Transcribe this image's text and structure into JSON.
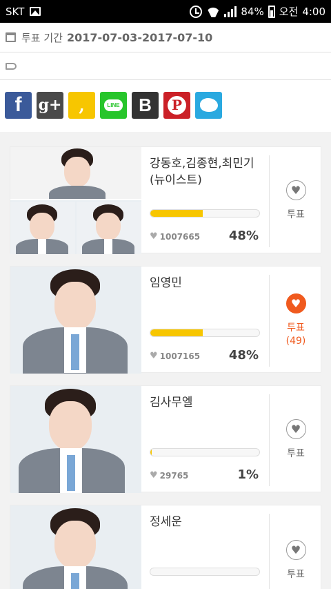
{
  "status_bar": {
    "carrier": "SKT",
    "battery": "84%",
    "ampm": "오전",
    "time": "4:00"
  },
  "period": {
    "label": "투표 기간",
    "value": "2017-07-03-2017-07-10"
  },
  "share": [
    "facebook",
    "google-plus",
    "kakaostory",
    "line",
    "band",
    "pinterest",
    "twitter"
  ],
  "share_text": {
    "line": "LINE",
    "band": "B",
    "fb": "f",
    "gp": "g+",
    "kakao": ",",
    "pin": "P"
  },
  "candidates": [
    {
      "name": "강동호,김종현,최민기(뉴이스트)",
      "votes": "1007665",
      "percent": "48%",
      "progress": 0.48,
      "vote_label": "투표",
      "vote_count": "",
      "voted": false
    },
    {
      "name": "임영민",
      "votes": "1007165",
      "percent": "48%",
      "progress": 0.48,
      "vote_label": "투표",
      "vote_count": "(49)",
      "voted": true
    },
    {
      "name": "김사무엘",
      "votes": "29765",
      "percent": "1%",
      "progress": 0.01,
      "vote_label": "투표",
      "vote_count": "",
      "voted": false
    },
    {
      "name": "정세운",
      "votes": "",
      "percent": "",
      "progress": 0,
      "vote_label": "투표",
      "vote_count": "",
      "voted": false
    }
  ],
  "colors": {
    "accent": "#f05a1e",
    "bar": "#f7c600"
  }
}
